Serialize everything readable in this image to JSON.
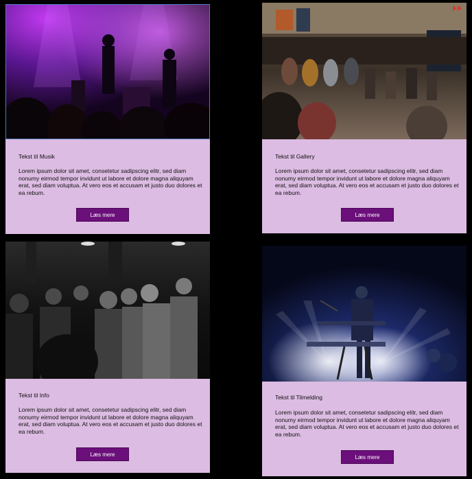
{
  "cards": [
    {
      "title": "Tekst til Musik",
      "body": " Lorem ipsum dolor sit amet, consetetur sadipscing elitr, sed diam nonumy eirmod tempor invidunt ut labore et dolore magna aliquyam erat, sed diam voluptua. At vero eos et accusam et justo duo dolores et ea rebum.",
      "button": "Læs mere",
      "image": "concert-band-purple-lights"
    },
    {
      "title": "Tekst til Gallery",
      "body": " Lorem ipsum dolor sit amet, consetetur sadipscing elitr, sed diam nonumy eirmod tempor invidunt ut labore et dolore magna aliquyam erat, sed diam voluptua. At vero eos et accusam et justo duo dolores et ea rebum.",
      "button": "Læs mere",
      "image": "drum-performance-crowd"
    },
    {
      "title": "Tekst til Info",
      "body": " Lorem ipsum dolor sit amet, consetetur sadipscing elitr, sed diam nonumy eirmod tempor invidunt ut labore et dolore magna aliquyam erat, sed diam voluptua. At vero eos et accusam et justo duo dolores et ea rebum.",
      "button": "Læs mere",
      "image": "black-white-audience"
    },
    {
      "title": "Tekst til Tilmelding",
      "body": " Lorem ipsum dolor sit amet, consetetur sadipscing elitr, sed diam nonumy eirmod tempor invidunt ut labore et dolore magna aliquyam erat, sed diam voluptua. At vero eos et accusam et justo duo dolores et ea rebum.",
      "button": "Læs mere",
      "image": "keyboard-player-stage-lights"
    }
  ],
  "colors": {
    "page_background": "#000000",
    "card_panel": "#dcbce2",
    "button_background": "#6b0f7a",
    "button_text": "#ffffff"
  }
}
